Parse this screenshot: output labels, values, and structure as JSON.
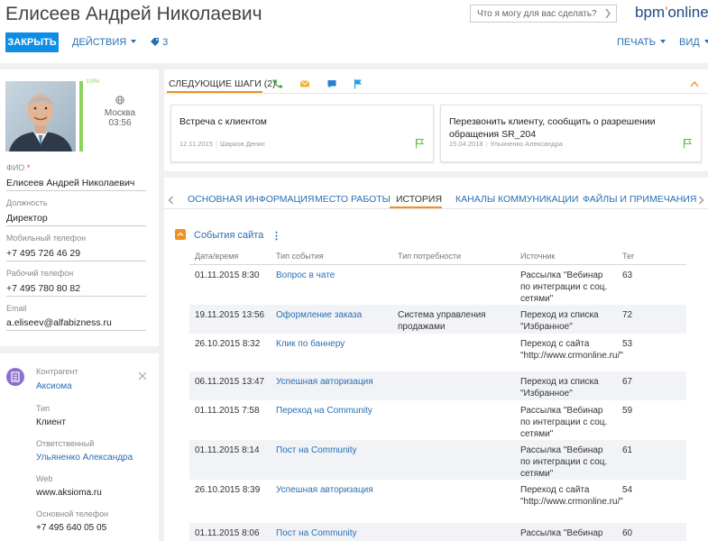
{
  "header": {
    "title": "Елисеев Андрей Николаевич",
    "search_placeholder": "Что я могу для вас сделать?",
    "logo_main": "bpm",
    "logo_o": "'",
    "logo_rest": "online",
    "close_label": "ЗАКРЫТЬ",
    "actions_label": "ДЕЙСТВИЯ",
    "tag_count": "3",
    "print_label": "ПЕЧАТЬ",
    "view_label": "ВИД"
  },
  "profile": {
    "completeness": "100%",
    "city": "Москва",
    "time": "03:56",
    "fields": [
      {
        "label": "ФИО",
        "required": "*",
        "value": "Елисеев Андрей Николаевич"
      },
      {
        "label": "Должность",
        "value": "Директор"
      },
      {
        "label": "Мобильный телефон",
        "value": "+7 495 726 46 29"
      },
      {
        "label": "Рабочий телефон",
        "value": "+7 495 780 80 82"
      },
      {
        "label": "Email",
        "value": "a.eliseev@alfabizness.ru"
      }
    ]
  },
  "account": {
    "label": "Контрагент",
    "name": "Аксиома",
    "type_label": "Тип",
    "type_value": "Клиент",
    "owner_label": "Ответственный",
    "owner_value": "Ульяненко Александра",
    "web_label": "Web",
    "web_value": "www.aksioma.ru",
    "phone_label": "Основной телефон",
    "phone_value": "+7 495 640 05 05"
  },
  "next_steps": {
    "title": "СЛЕДУЮЩИЕ ШАГИ (2)",
    "cards": [
      {
        "title": "Встреча с клиентом",
        "date": "12.11.2015",
        "person": "Шарков Денис"
      },
      {
        "title": "Перезвонить клиенту, сообщить о разрешении обращения SR_204",
        "date": "15.04.2018",
        "person": "Ульяненко Александра"
      }
    ]
  },
  "tabs": [
    {
      "label": "ОСНОВНАЯ ИНФОРМАЦИЯ"
    },
    {
      "label": "МЕСТО РАБОТЫ"
    },
    {
      "label": "ИСТОРИЯ"
    },
    {
      "label": "КАНАЛЫ КОММУНИКАЦИИ"
    },
    {
      "label": "ФАЙЛЫ И ПРИМЕЧАНИЯ"
    }
  ],
  "detail": {
    "title": "События сайта",
    "menu": "⋮",
    "columns": [
      "Дата/время",
      "Тип события",
      "Тип потребности",
      "Источник",
      "Тег"
    ],
    "rows": [
      {
        "date": "01.11.2015 8:30",
        "event": "Вопрос в чате",
        "need": "",
        "source": "Рассылка \"Вебинар по интеграции с соц. сетями\"",
        "tag": "63"
      },
      {
        "date": "19.11.2015 13:56",
        "event": "Оформление заказа",
        "need": "Система управления продажами",
        "source": "Переход из списка \"Избранное\"",
        "tag": "72"
      },
      {
        "date": "26.10.2015 8:32",
        "event": "Клик по баннеру",
        "need": "",
        "source": "Переход с сайта \"http://www.crmonline.ru/\"",
        "tag": "53"
      },
      {
        "date": "06.11.2015 13:47",
        "event": "Успешная авторизация",
        "need": "",
        "source": "Переход из списка \"Избранное\"",
        "tag": "67"
      },
      {
        "date": "01.11.2015 7:58",
        "event": "Переход на Community",
        "need": "",
        "source": "Рассылка \"Вебинар по интеграции с соц. сетями\"",
        "tag": "59"
      },
      {
        "date": "01.11.2015 8:14",
        "event": "Пост на Community",
        "need": "",
        "source": "Рассылка \"Вебинар по интеграции с соц. сетями\"",
        "tag": "61"
      },
      {
        "date": "26.10.2015 8:39",
        "event": "Успешная авторизация",
        "need": "",
        "source": "Переход с сайта \"http://www.crmonline.ru/\"",
        "tag": "54"
      },
      {
        "date": "01.11.2015 8:06",
        "event": "Пост на Community",
        "need": "",
        "source": "Рассылка \"Вебинар по",
        "tag": "60"
      }
    ]
  },
  "colors": {
    "accent": "#0d8ee6",
    "link": "#2a6fb3",
    "orange": "#f38f1d",
    "green": "#8cd35f"
  }
}
